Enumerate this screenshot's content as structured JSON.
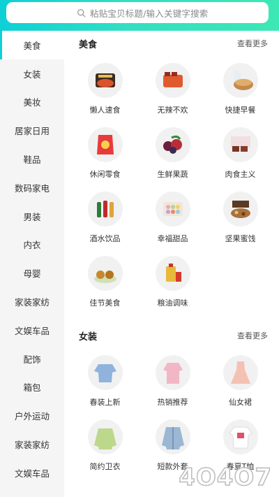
{
  "search": {
    "placeholder": "粘贴宝贝标题/输入关键字搜索"
  },
  "sidebar": {
    "items": [
      {
        "label": "美食"
      },
      {
        "label": "女装"
      },
      {
        "label": "美妆"
      },
      {
        "label": "居家日用"
      },
      {
        "label": "鞋品"
      },
      {
        "label": "数码家电"
      },
      {
        "label": "男装"
      },
      {
        "label": "内衣"
      },
      {
        "label": "母婴"
      },
      {
        "label": "家装家纺"
      },
      {
        "label": "文娱车品"
      },
      {
        "label": "配饰"
      },
      {
        "label": "箱包"
      },
      {
        "label": "户外运动"
      },
      {
        "label": "家装家纺"
      },
      {
        "label": "文娱车品"
      }
    ]
  },
  "sections": [
    {
      "title": "美食",
      "more": "查看更多",
      "items": [
        {
          "label": "懒人速食"
        },
        {
          "label": "无辣不欢"
        },
        {
          "label": "快捷早餐"
        },
        {
          "label": "休闲零食"
        },
        {
          "label": "生鲜果蔬"
        },
        {
          "label": "肉食主义"
        },
        {
          "label": "酒水饮品"
        },
        {
          "label": "幸福甜品"
        },
        {
          "label": "坚果蜜饯"
        },
        {
          "label": "佳节美食"
        },
        {
          "label": "粮油调味"
        }
      ]
    },
    {
      "title": "女装",
      "more": "查看更多",
      "items": [
        {
          "label": "春装上新"
        },
        {
          "label": "热销推荐"
        },
        {
          "label": "仙女裙"
        },
        {
          "label": "简约卫衣"
        },
        {
          "label": "短款外套"
        },
        {
          "label": "春夏T恤"
        }
      ]
    }
  ],
  "watermark": "4O4O7",
  "colors": {
    "accent": "#0ed0d6",
    "sidebar_bg": "#f5f5f5"
  }
}
